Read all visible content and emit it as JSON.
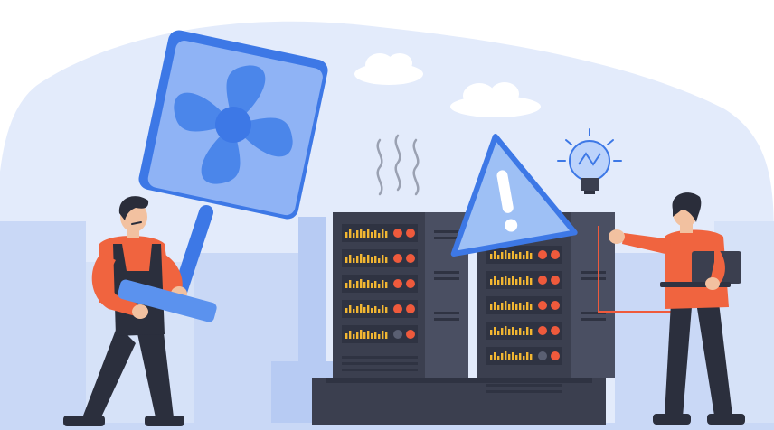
{
  "scene": {
    "subject": "server-overheating-illustration",
    "colors": {
      "sky_blob": "#dfe8fb",
      "building_light": "#c9d8f6",
      "building_mid": "#b7cbf3",
      "rack_dark": "#3b3f4f",
      "rack_panel": "#2f3342",
      "rack_side": "#4a4f62",
      "accent_blue": "#3d78e6",
      "fan_blue": "#4b86ea",
      "fan_frame": "#5b92ee",
      "led_red": "#ef5a3c",
      "bar_yellow": "#f2b632",
      "shirt_orange": "#f0643f",
      "pants_dark": "#2b2f3d",
      "skin": "#f2c1a0",
      "hair": "#2a2d3a",
      "cloud": "#ffffff"
    },
    "icons": [
      "fan-icon",
      "warning-icon",
      "lightbulb-icon",
      "heat-waves-icon",
      "laptop-icon"
    ]
  }
}
